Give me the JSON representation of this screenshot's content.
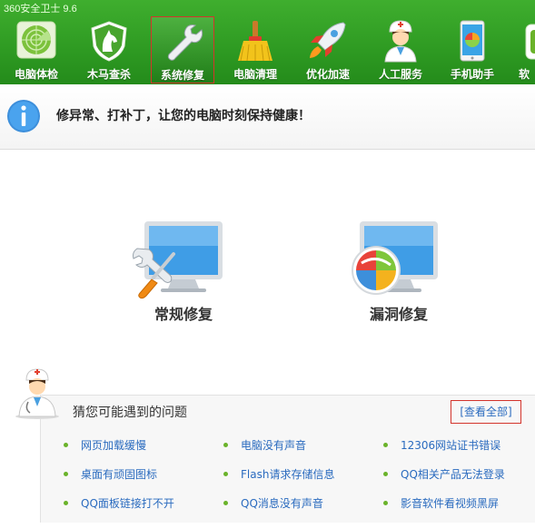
{
  "app": {
    "title": "360安全卫士 9.6"
  },
  "toolbar": {
    "items": [
      {
        "label": "电脑体检",
        "icon": "radar-icon"
      },
      {
        "label": "木马查杀",
        "icon": "horse-shield-icon"
      },
      {
        "label": "系统修复",
        "icon": "wrench-icon",
        "active": true
      },
      {
        "label": "电脑清理",
        "icon": "broom-icon"
      },
      {
        "label": "优化加速",
        "icon": "rocket-icon"
      },
      {
        "label": "人工服务",
        "icon": "doctor-icon"
      },
      {
        "label": "手机助手",
        "icon": "phone-icon"
      },
      {
        "label": "软",
        "icon": "software-icon"
      }
    ]
  },
  "banner": {
    "message": "修异常、打补丁，让您的电脑时刻保持健康！"
  },
  "options": [
    {
      "label": "常规修复",
      "icon": "monitor-tools-icon"
    },
    {
      "label": "漏洞修复",
      "icon": "monitor-windows-icon"
    }
  ],
  "problems": {
    "title": "猜您可能遇到的问题",
    "view_all": "[查看全部]",
    "items": [
      "网页加载缓慢",
      "电脑没有声音",
      "12306网站证书错误",
      "桌面有顽固图标",
      "Flash请求存储信息",
      "QQ相关产品无法登录",
      "QQ面板链接打不开",
      "QQ消息没有声音",
      "影音软件看视频黑屏"
    ]
  },
  "colors": {
    "toolbar_green": "#2e9a22",
    "link_blue": "#2a6bbf",
    "highlight_red": "#d3342c",
    "bullet_green": "#6ab32a"
  }
}
